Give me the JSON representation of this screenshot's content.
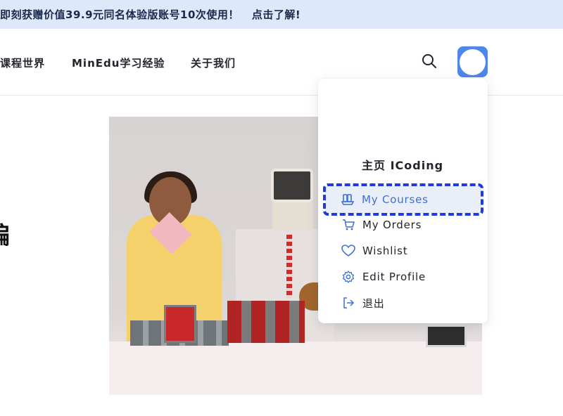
{
  "promo": {
    "text": "即刻获赠价值39.9元同名体验版账号10次使用！",
    "cta": "点击了解!"
  },
  "nav": {
    "items": [
      {
        "label": "课程世界"
      },
      {
        "label": "MinEdu学习经验"
      },
      {
        "label": "关于我们"
      }
    ]
  },
  "header": {
    "search_icon": "search-icon",
    "avatar_icon": "avatar"
  },
  "hero": {
    "heading_fragment": "编"
  },
  "user_menu": {
    "title": "主页 ICoding",
    "items": [
      {
        "label": "My Courses",
        "icon": "courses-icon",
        "active": true
      },
      {
        "label": "My Orders",
        "icon": "cart-icon"
      },
      {
        "label": "Wishlist",
        "icon": "heart-icon"
      },
      {
        "label": "Edit Profile",
        "icon": "gear-icon"
      },
      {
        "label": "退出",
        "icon": "logout-icon"
      }
    ]
  },
  "colors": {
    "accent": "#3e6fd8",
    "avatar_bg": "#4f86ec",
    "promo_bg": "#dde8fb",
    "highlight_outline": "#1f3ae0"
  }
}
